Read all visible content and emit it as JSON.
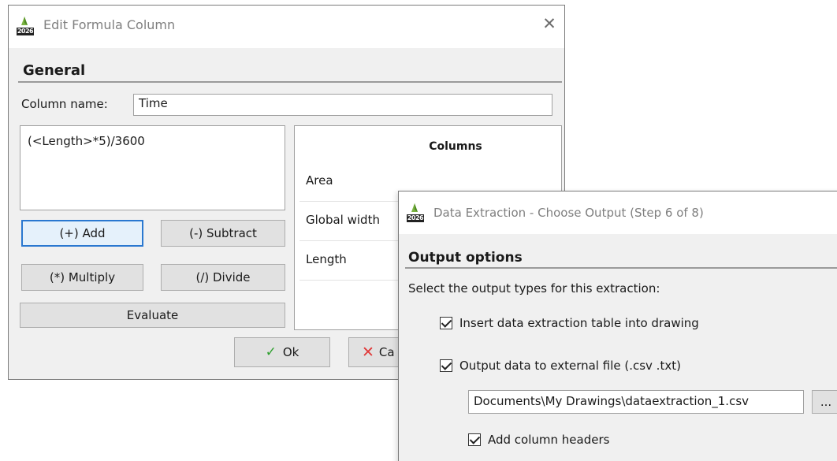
{
  "formula_dialog": {
    "title": "Edit Formula Column",
    "app_icon_year": "2026",
    "close_glyph": "✕",
    "section_title": "General",
    "column_name_label": "Column name:",
    "column_name_value": "Time",
    "formula": "(<Length>*5)/3600",
    "buttons": {
      "add": "(+) Add",
      "subtract": "(-) Subtract",
      "multiply": "(*) Multiply",
      "divide": "(/) Divide",
      "evaluate": "Evaluate",
      "ok": "Ok",
      "cancel_visible": "Ca"
    },
    "columns_panel": {
      "header": "Columns",
      "items": [
        "Area",
        "Global width",
        "Length"
      ]
    },
    "icons": {
      "ok": "check-icon",
      "cancel": "x-icon",
      "close": "close-icon"
    }
  },
  "extraction_dialog": {
    "title": "Data Extraction - Choose Output (Step 6 of 8)",
    "app_icon_year": "2026",
    "section_title": "Output options",
    "prompt": "Select the output types for this extraction:",
    "options": [
      {
        "label": "Insert data extraction table into drawing",
        "checked": true
      },
      {
        "label": "Output data to external file (.csv .txt)",
        "checked": true
      }
    ],
    "file_path": "Documents\\My Drawings\\dataextraction_1.csv",
    "browse_label": "...",
    "add_headers": {
      "label": "Add column headers",
      "checked": true
    }
  },
  "colors": {
    "dialog_bg": "#f0f0f0",
    "focus_border": "#2a78d0",
    "ok_check": "#2fa02f",
    "cancel_x": "#e03a3a",
    "icon_leaf": "#7bb342"
  }
}
